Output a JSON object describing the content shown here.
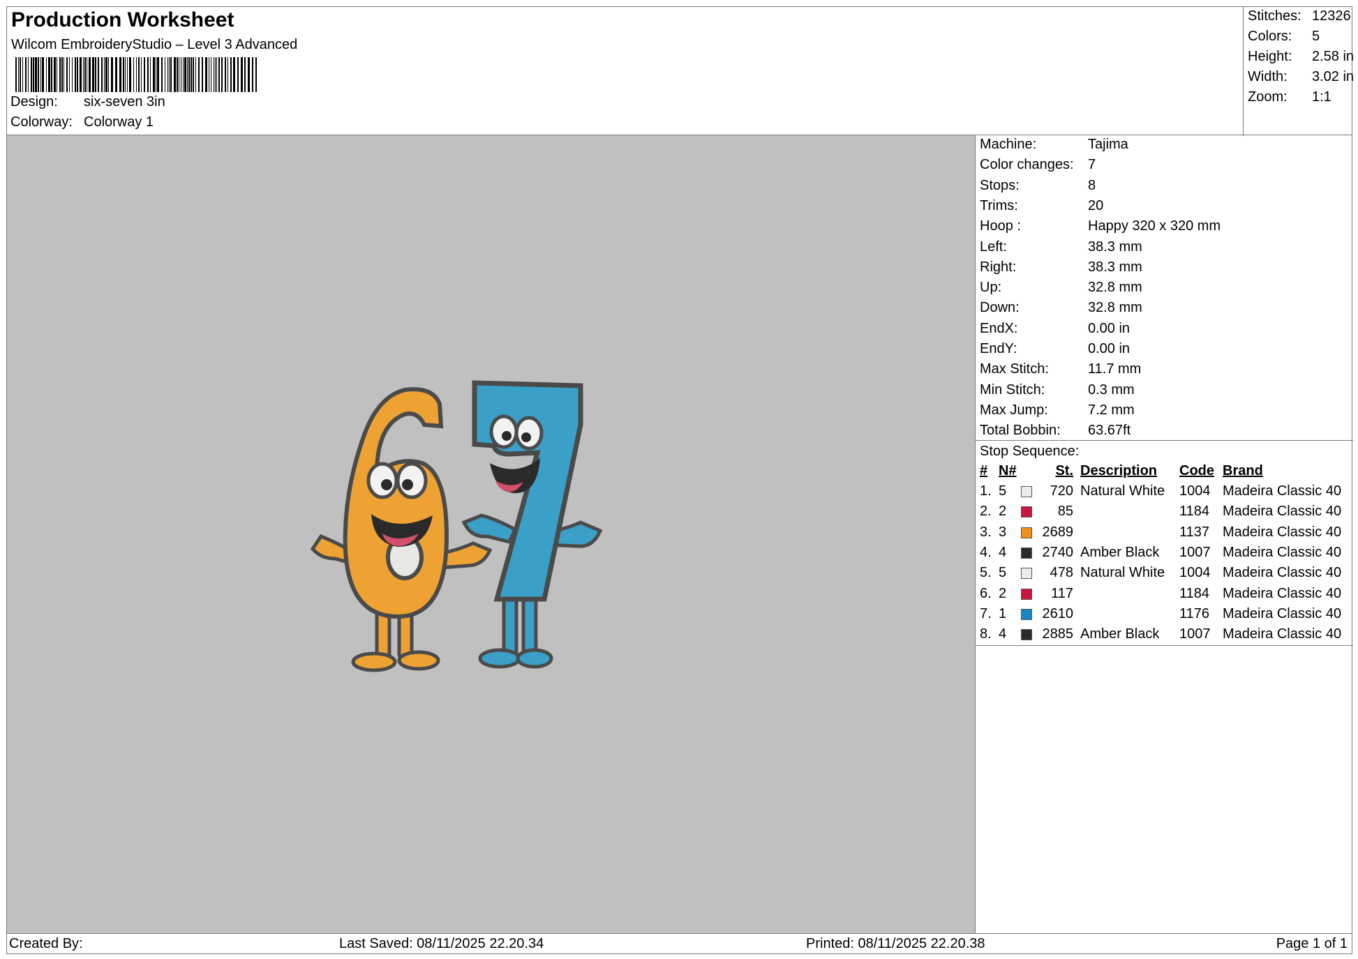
{
  "header": {
    "title": "Production Worksheet",
    "subtitle": "Wilcom EmbroideryStudio – Level 3 Advanced",
    "design_label": "Design:",
    "design_value": "six-seven 3in",
    "colorway_label": "Colorway:",
    "colorway_value": "Colorway 1"
  },
  "stats": [
    {
      "label": "Stitches:",
      "value": "12326"
    },
    {
      "label": "Colors:",
      "value": "5"
    },
    {
      "label": "Height:",
      "value": "2.58 in"
    },
    {
      "label": "Width:",
      "value": "3.02 in"
    },
    {
      "label": "Zoom:",
      "value": "1:1"
    }
  ],
  "machine": [
    {
      "label": "Machine:",
      "value": "Tajima"
    },
    {
      "label": "Color changes:",
      "value": "7"
    },
    {
      "label": "Stops:",
      "value": "8"
    },
    {
      "label": "Trims:",
      "value": "20"
    },
    {
      "label": "Hoop :",
      "value": "Happy 320 x 320 mm"
    },
    {
      "label": "Left:",
      "value": "38.3 mm"
    },
    {
      "label": "Right:",
      "value": "38.3 mm"
    },
    {
      "label": "Up:",
      "value": "32.8 mm"
    },
    {
      "label": "Down:",
      "value": "32.8 mm"
    },
    {
      "label": "EndX:",
      "value": "0.00 in"
    },
    {
      "label": "EndY:",
      "value": "0.00 in"
    },
    {
      "label": "Max Stitch:",
      "value": "11.7 mm"
    },
    {
      "label": "Min Stitch:",
      "value": "0.3 mm"
    },
    {
      "label": "Max Jump:",
      "value": "7.2 mm"
    },
    {
      "label": "Total Bobbin:",
      "value": "63.67ft"
    }
  ],
  "stop_sequence": {
    "title": "Stop Sequence:",
    "headers": {
      "num": "#",
      "n": "N#",
      "st": "St.",
      "desc": "Description",
      "code": "Code",
      "brand": "Brand"
    },
    "rows": [
      {
        "num": "1.",
        "n": "5",
        "color": "#ececf0",
        "st": "720",
        "desc": "Natural White",
        "code": "1004",
        "brand": "Madeira Classic 40"
      },
      {
        "num": "2.",
        "n": "2",
        "color": "#c8173c",
        "st": "85",
        "desc": "",
        "code": "1184",
        "brand": "Madeira Classic 40"
      },
      {
        "num": "3.",
        "n": "3",
        "color": "#f0901e",
        "st": "2689",
        "desc": "",
        "code": "1137",
        "brand": "Madeira Classic 40"
      },
      {
        "num": "4.",
        "n": "4",
        "color": "#2a2a2a",
        "st": "2740",
        "desc": "Amber Black",
        "code": "1007",
        "brand": "Madeira Classic 40"
      },
      {
        "num": "5.",
        "n": "5",
        "color": "#ececf0",
        "st": "478",
        "desc": "Natural White",
        "code": "1004",
        "brand": "Madeira Classic 40"
      },
      {
        "num": "6.",
        "n": "2",
        "color": "#c8173c",
        "st": "117",
        "desc": "",
        "code": "1184",
        "brand": "Madeira Classic 40"
      },
      {
        "num": "7.",
        "n": "1",
        "color": "#1a86c4",
        "st": "2610",
        "desc": "",
        "code": "1176",
        "brand": "Madeira Classic 40"
      },
      {
        "num": "8.",
        "n": "4",
        "color": "#2a2a2a",
        "st": "2885",
        "desc": "Amber Black",
        "code": "1007",
        "brand": "Madeira Classic 40"
      }
    ]
  },
  "footer": {
    "created": "Created By:",
    "saved": "Last Saved: 08/11/2025 22.20.34",
    "printed": "Printed: 08/11/2025 22.20.38",
    "page": "Page 1 of 1"
  },
  "colors": {
    "canvas_bg": "#c0c0c0",
    "six_fill": "#eea233",
    "seven_fill": "#3aa0c8",
    "outline": "#4a4a4a"
  }
}
